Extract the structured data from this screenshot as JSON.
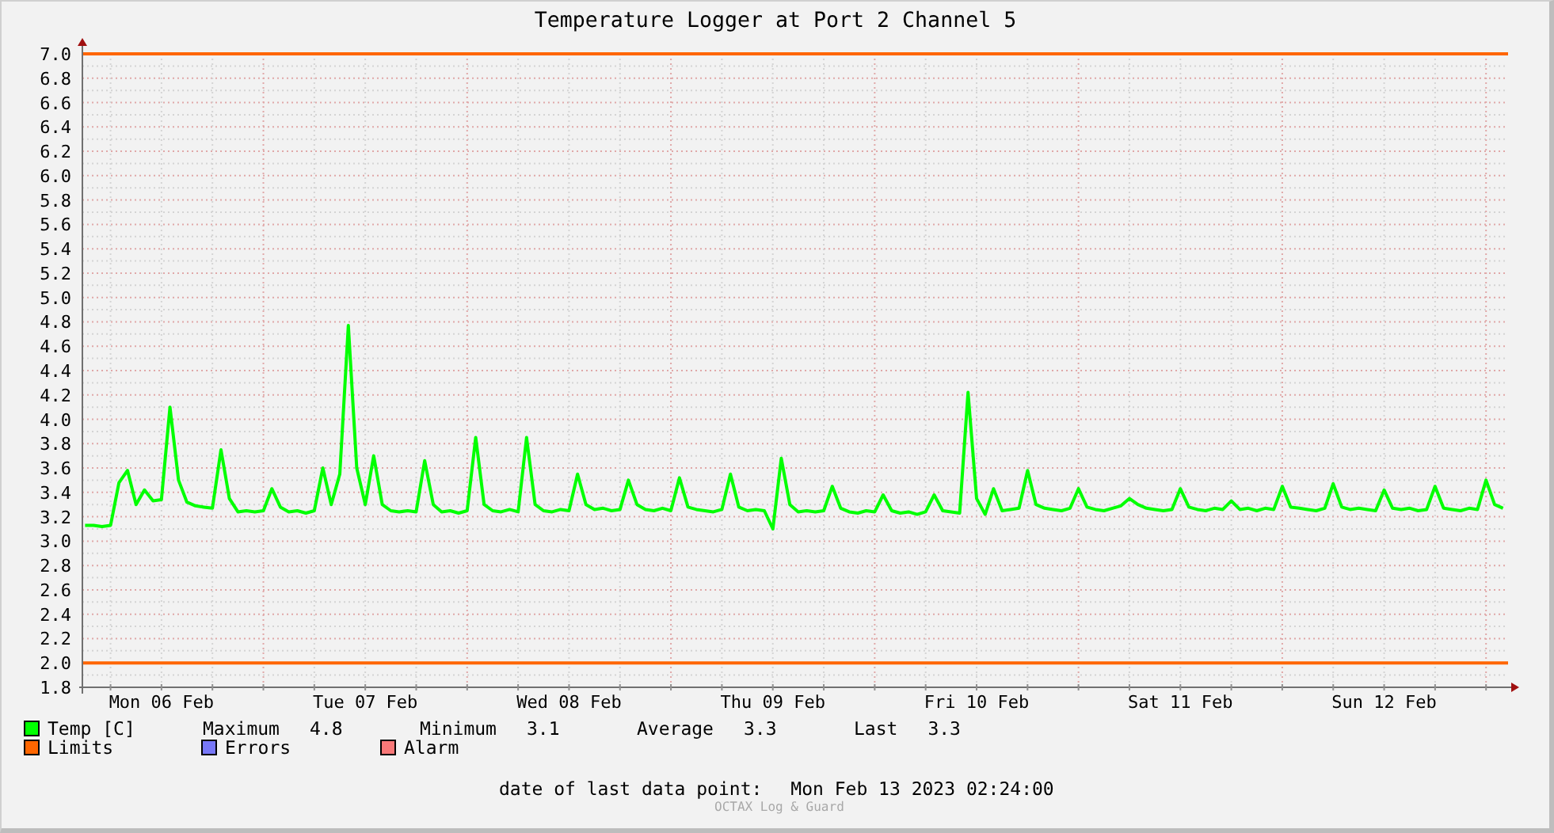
{
  "window": {
    "title": "Temperature Logger at Port 2 Channel 5"
  },
  "chart": {
    "chart_data": {
      "type": "line",
      "ylim": [
        1.8,
        7.0
      ],
      "categories": [
        null,
        null,
        null,
        null,
        null,
        null,
        null,
        null,
        null,
        "Mon 06 Feb",
        null,
        null,
        null,
        null,
        null,
        null,
        null,
        null,
        null,
        null,
        null,
        null,
        null,
        null,
        null,
        null,
        null,
        null,
        null,
        null,
        null,
        null,
        null,
        "Tue 07 Feb",
        null,
        null,
        null,
        null,
        null,
        null,
        null,
        null,
        null,
        null,
        null,
        null,
        null,
        null,
        null,
        null,
        null,
        null,
        null,
        null,
        null,
        null,
        null,
        "Wed 08 Feb",
        null,
        null,
        null,
        null,
        null,
        null,
        null,
        null,
        null,
        null,
        null,
        null,
        null,
        null,
        null,
        null,
        null,
        null,
        null,
        null,
        null,
        null,
        null,
        "Thu 09 Feb",
        null,
        null,
        null,
        null,
        null,
        null,
        null,
        null,
        null,
        null,
        null,
        null,
        null,
        null,
        null,
        null,
        null,
        null,
        null,
        null,
        null,
        null,
        null,
        "Fri 10 Feb",
        null,
        null,
        null,
        null,
        null,
        null,
        null,
        null,
        null,
        null,
        null,
        null,
        null,
        null,
        null,
        null,
        null,
        null,
        null,
        null,
        null,
        null,
        null,
        "Sat 11 Feb",
        null,
        null,
        null,
        null,
        null,
        null,
        null,
        null,
        null,
        null,
        null,
        null,
        null,
        null,
        null,
        null,
        null,
        null,
        null,
        null,
        null,
        null,
        null,
        "Sun 12 Feb",
        null,
        null,
        null,
        null,
        null,
        null,
        null,
        null,
        null,
        null,
        null,
        null,
        null,
        null
      ],
      "yticks": [
        {
          "value": 1.8,
          "label": "1.8"
        },
        {
          "value": 2.0,
          "label": "2.0"
        },
        {
          "value": 2.2,
          "label": "2.2"
        },
        {
          "value": 2.4,
          "label": "2.4"
        },
        {
          "value": 2.6,
          "label": "2.6"
        },
        {
          "value": 2.8,
          "label": "2.8"
        },
        {
          "value": 3.0,
          "label": "3.0"
        },
        {
          "value": 3.2,
          "label": "3.2"
        },
        {
          "value": 3.4,
          "label": "3.4"
        },
        {
          "value": 3.6,
          "label": "3.6"
        },
        {
          "value": 3.8,
          "label": "3.8"
        },
        {
          "value": 4.0,
          "label": "4.0"
        },
        {
          "value": 4.2,
          "label": "4.2"
        },
        {
          "value": 4.4,
          "label": "4.4"
        },
        {
          "value": 4.6,
          "label": "4.6"
        },
        {
          "value": 4.8,
          "label": "4.8"
        },
        {
          "value": 5.0,
          "label": "5.0"
        },
        {
          "value": 5.2,
          "label": "5.2"
        },
        {
          "value": 5.4,
          "label": "5.4"
        },
        {
          "value": 5.6,
          "label": "5.6"
        },
        {
          "value": 5.8,
          "label": "5.8"
        },
        {
          "value": 6.0,
          "label": "6.0"
        },
        {
          "value": 6.2,
          "label": "6.2"
        },
        {
          "value": 6.4,
          "label": "6.4"
        },
        {
          "value": 6.6,
          "label": "6.6"
        },
        {
          "value": 6.8,
          "label": "6.8"
        },
        {
          "value": 7.0,
          "label": "7.0"
        }
      ],
      "series": [
        {
          "name": "Temp [C]",
          "color": "#00ff00",
          "values": [
            3.13,
            3.13,
            3.12,
            3.13,
            3.48,
            3.58,
            3.3,
            3.42,
            3.33,
            3.34,
            4.1,
            3.5,
            3.32,
            3.29,
            3.28,
            3.27,
            3.75,
            3.35,
            3.24,
            3.25,
            3.24,
            3.25,
            3.43,
            3.28,
            3.24,
            3.25,
            3.23,
            3.25,
            3.6,
            3.3,
            3.55,
            4.77,
            3.6,
            3.3,
            3.7,
            3.3,
            3.25,
            3.24,
            3.25,
            3.24,
            3.66,
            3.3,
            3.24,
            3.25,
            3.23,
            3.25,
            3.85,
            3.3,
            3.25,
            3.24,
            3.26,
            3.24,
            3.85,
            3.3,
            3.25,
            3.24,
            3.26,
            3.25,
            3.55,
            3.3,
            3.26,
            3.27,
            3.25,
            3.26,
            3.5,
            3.3,
            3.26,
            3.25,
            3.27,
            3.25,
            3.52,
            3.28,
            3.26,
            3.25,
            3.24,
            3.26,
            3.55,
            3.28,
            3.25,
            3.26,
            3.25,
            3.1,
            3.68,
            3.3,
            3.24,
            3.25,
            3.24,
            3.25,
            3.45,
            3.27,
            3.24,
            3.23,
            3.25,
            3.24,
            3.38,
            3.25,
            3.23,
            3.24,
            3.22,
            3.24,
            3.38,
            3.25,
            3.24,
            3.23,
            4.22,
            3.35,
            3.22,
            3.43,
            3.25,
            3.26,
            3.27,
            3.58,
            3.3,
            3.27,
            3.26,
            3.25,
            3.27,
            3.43,
            3.28,
            3.26,
            3.25,
            3.27,
            3.29,
            3.35,
            3.3,
            3.27,
            3.26,
            3.25,
            3.26,
            3.43,
            3.28,
            3.26,
            3.25,
            3.27,
            3.26,
            3.33,
            3.26,
            3.27,
            3.25,
            3.27,
            3.26,
            3.45,
            3.28,
            3.27,
            3.26,
            3.25,
            3.27,
            3.47,
            3.28,
            3.26,
            3.27,
            3.26,
            3.25,
            3.42,
            3.27,
            3.26,
            3.27,
            3.25,
            3.26,
            3.45,
            3.27,
            3.26,
            3.25,
            3.27,
            3.26,
            3.5,
            3.3,
            3.27
          ]
        }
      ],
      "grid": true,
      "ref_lines": [
        {
          "axis": "y",
          "value": 7.0
        },
        {
          "axis": "y",
          "value": 2.0
        }
      ]
    }
  },
  "legend": {
    "items": [
      {
        "label": "Limits",
        "color": "#ff6600"
      },
      {
        "label": "Errors",
        "color": "#7878f8"
      },
      {
        "label": "Alarm",
        "color": "#f87878"
      }
    ],
    "stats": [
      {
        "label": "Maximum",
        "value": "4.8"
      },
      {
        "label": "Minimum",
        "value": "3.1"
      },
      {
        "label": "Average",
        "value": "3.3"
      },
      {
        "label": "Last",
        "value": "3.3"
      }
    ]
  },
  "footer": {
    "label": "date of last data point:",
    "value": "Mon Feb 13 2023 02:24:00"
  },
  "credit": "OCTAX Log & Guard"
}
